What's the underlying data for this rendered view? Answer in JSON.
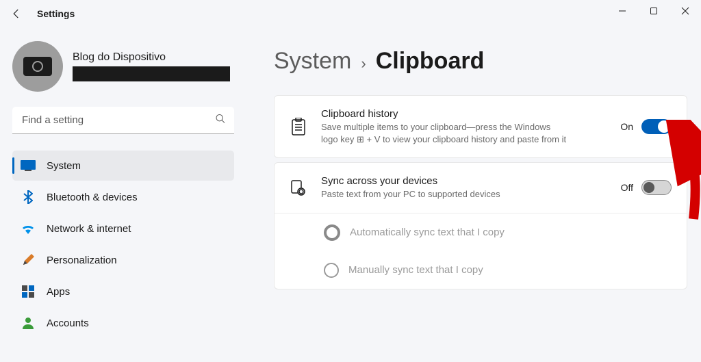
{
  "window": {
    "title": "Settings"
  },
  "profile": {
    "name": "Blog do Dispositivo"
  },
  "search": {
    "placeholder": "Find a setting"
  },
  "nav": {
    "items": [
      {
        "label": "System"
      },
      {
        "label": "Bluetooth & devices"
      },
      {
        "label": "Network & internet"
      },
      {
        "label": "Personalization"
      },
      {
        "label": "Apps"
      },
      {
        "label": "Accounts"
      }
    ]
  },
  "breadcrumb": {
    "root": "System",
    "leaf": "Clipboard"
  },
  "cards": {
    "history": {
      "title": "Clipboard history",
      "desc": "Save multiple items to your clipboard—press the Windows logo key ⊞ + V to view your clipboard history and paste from it",
      "state": "On"
    },
    "sync": {
      "title": "Sync across your devices",
      "desc": "Paste text from your PC to supported devices",
      "state": "Off",
      "option1": "Automatically sync text that I copy",
      "option2": "Manually sync text that I copy"
    }
  }
}
